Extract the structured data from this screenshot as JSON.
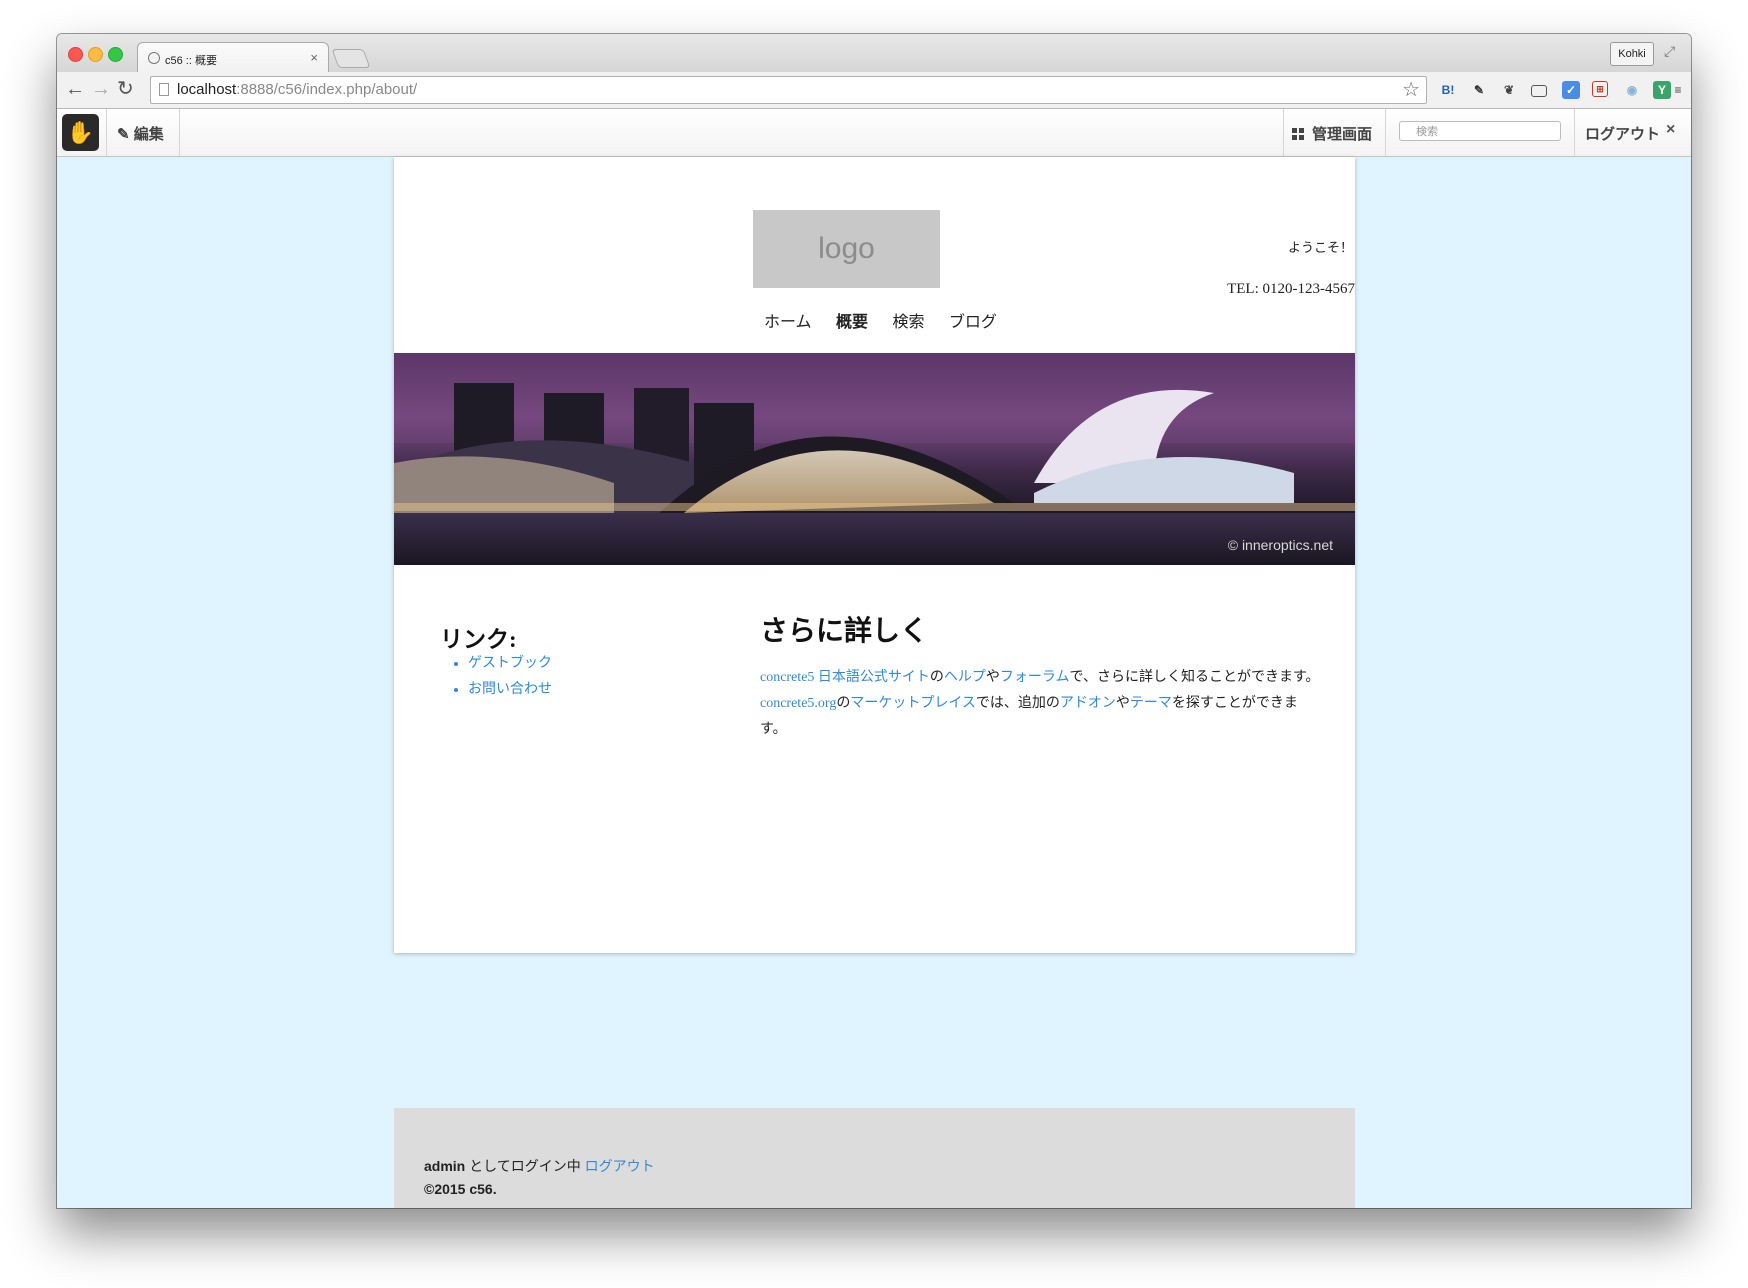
{
  "browser": {
    "tab_title": "c56 :: 概要",
    "tab_close": "×",
    "profile_name": "Kohki",
    "url_host": "localhost",
    "url_rest": ":8888/c56/index.php/about/",
    "ext_hatena": "B!"
  },
  "c5toolbar": {
    "edit_label": "編集",
    "dashboard_label": "管理画面",
    "search_placeholder": "検索",
    "logout_label": "ログアウト",
    "close_label": "×"
  },
  "header": {
    "logo_text": "logo",
    "welcome": "ようこそ！",
    "tel": "TEL: 0120-123-4567",
    "nav": [
      {
        "label": "ホーム"
      },
      {
        "label": "概要"
      },
      {
        "label": "検索"
      },
      {
        "label": "ブログ"
      }
    ]
  },
  "banner": {
    "credit": "© inneroptics.net"
  },
  "sidebar": {
    "title": "リンク:",
    "links": [
      {
        "label": "ゲストブック"
      },
      {
        "label": "お問い合わせ"
      }
    ]
  },
  "main": {
    "title": "さらに詳しく",
    "p1_link1": "concrete5 日本語公式サイト",
    "p1_t1": "の",
    "p1_link2": "ヘルプ",
    "p1_t2": "や",
    "p1_link3": "フォーラム",
    "p1_t3": "で、さらに詳しく知ることができます。",
    "p1_link4": "concrete5.org",
    "p1_t4": "の",
    "p1_link5": "マーケットプレイス",
    "p1_t5": "では、追加の",
    "p1_link6": "アドオン",
    "p1_t6": "や",
    "p1_link7": "テーマ",
    "p1_t7": "を探すことができます。"
  },
  "footer": {
    "user": "admin",
    "logged_in_text": " としてログイン中 ",
    "logout_link": "ログアウト",
    "copyright": "©2015 c56."
  },
  "colors": {
    "page_background": "#dff4ff",
    "link": "#3389d6",
    "footer_background": "#dcdcdc"
  }
}
